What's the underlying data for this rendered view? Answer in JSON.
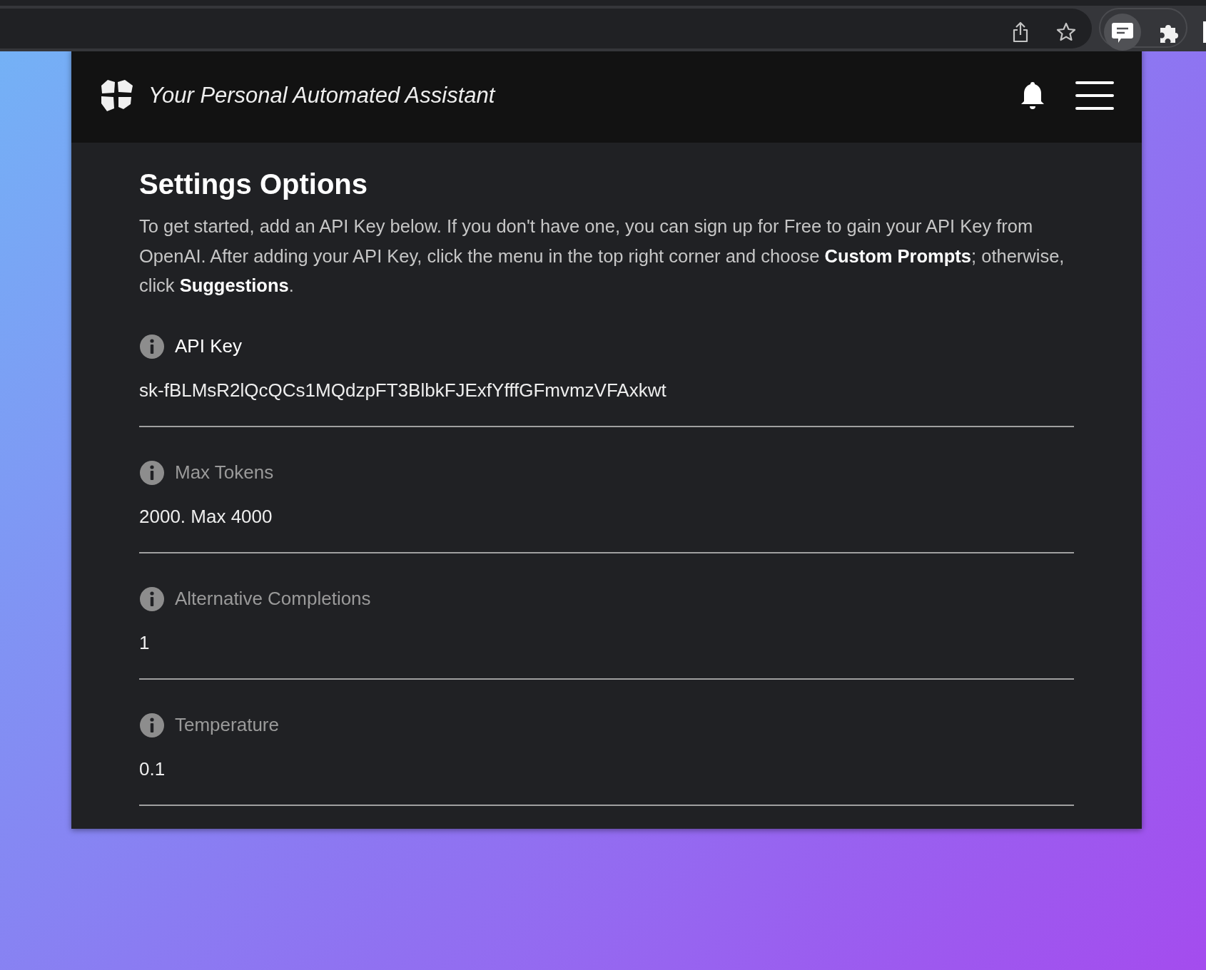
{
  "header": {
    "title": "Your Personal Automated Assistant"
  },
  "page": {
    "title": "Settings Options",
    "intro": "To get started, add an API Key below. If you don't have one, you can sign up for Free to gain your API Key from OpenAI. After adding your API Key, click the menu in the top right corner and choose **Custom Prompts**; otherwise, click **Suggestions**."
  },
  "fields": [
    {
      "label": "API Key",
      "value": "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",
      "active": true
    },
    {
      "label": "Max Tokens",
      "value": "2000. Max 4000",
      "active": false
    },
    {
      "label": "Alternative Completions",
      "value": "1",
      "active": false
    },
    {
      "label": "Temperature",
      "value": "0.1",
      "active": false
    }
  ]
}
